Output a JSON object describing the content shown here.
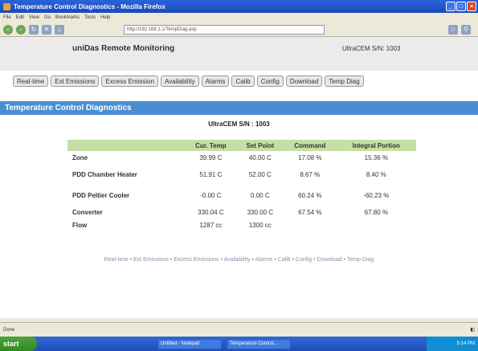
{
  "browser": {
    "title": "Temperature Control Diagnostics - Mozilla Firefox",
    "menu": [
      "File",
      "Edit",
      "View",
      "Go",
      "Bookmarks",
      "Tools",
      "Help"
    ],
    "address": "http://192.168.1.1/TempDiag.asp"
  },
  "header": {
    "brand": "uniDas Remote Monitoring",
    "serial": "UltraCEM S/N: 1003"
  },
  "nav": [
    "Real-time",
    "Ext Emissions",
    "Excess Emission",
    "Availability",
    "Alarms",
    "Calib",
    "Config",
    "Download",
    "Temp Diag"
  ],
  "page": {
    "title": "Temperature Control Diagnostics",
    "serial_label": "UltraCEM S/N : 1003"
  },
  "table": {
    "headers": [
      "",
      "Cur. Temp",
      "Set Point",
      "Command",
      "Integral Portion"
    ],
    "rows": [
      {
        "label": "Zone",
        "cur": "39.99 C",
        "set": "40.00 C",
        "cmd": "17.08 %",
        "integral": "15.36 %"
      },
      {
        "label": "PDD Chamber Heater",
        "cur": "51.91 C",
        "set": "52.00 C",
        "cmd": "8.67 %",
        "integral": "8.40 %"
      },
      {
        "label": "PDD Peltier Cooler",
        "cur": "-0.00 C",
        "set": "0.00 C",
        "cmd": "60.24 %",
        "integral": "-60.23 %"
      },
      {
        "label": "Converter",
        "cur": "330.04 C",
        "set": "330.00 C",
        "cmd": "67.54 %",
        "integral": "67.80 %"
      },
      {
        "label": "Flow",
        "cur": "1287 cc",
        "set": "1300 cc",
        "cmd": "",
        "integral": ""
      }
    ]
  },
  "footer_links": "Real-time • Ext Emissions • Excess Emissions • Availability • Alarms • Calib • Config • Download • Temp Diag",
  "status": {
    "text": "Done"
  },
  "taskbar": {
    "start": "start",
    "items": [
      "Untitled - Notepad",
      "Temperature Control..."
    ],
    "clock": "5:14 PM"
  }
}
